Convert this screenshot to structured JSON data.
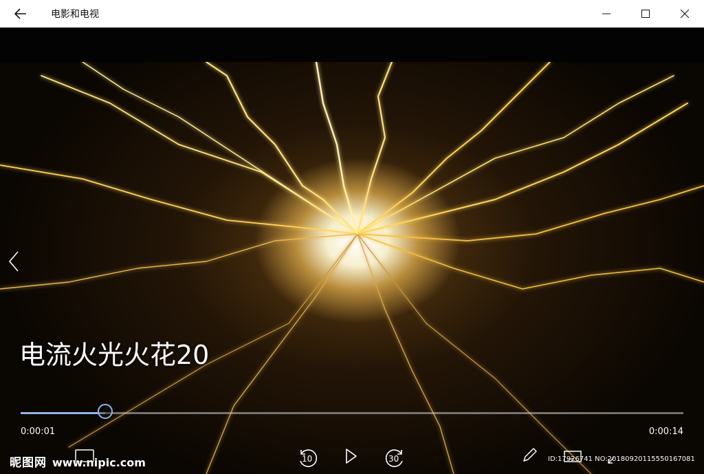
{
  "window": {
    "title": "电影和电视",
    "back_icon": "arrow-left-icon",
    "minimize_icon": "minimize-icon",
    "maximize_icon": "maximize-icon",
    "close_icon": "close-icon"
  },
  "player": {
    "video_title": "电流火光火花20",
    "elapsed": "0:00:01",
    "total": "0:00:14",
    "progress": 0.128,
    "accent_color": "#8fb7e6",
    "controls": {
      "skip_back_label": "10",
      "skip_forward_label": "30",
      "play_icon": "play-icon",
      "edit_icon": "pencil-icon",
      "subtitles_icon": "subtitles-icon",
      "cast_icon": "cast-icon",
      "fullscreen_icon": "fullscreen-icon",
      "prev_icon": "chevron-left-icon"
    }
  },
  "watermark": {
    "brand": "昵图网",
    "url": "www.nipic.com",
    "id_text": "ID:17926741 NO:20180920115550167081"
  }
}
